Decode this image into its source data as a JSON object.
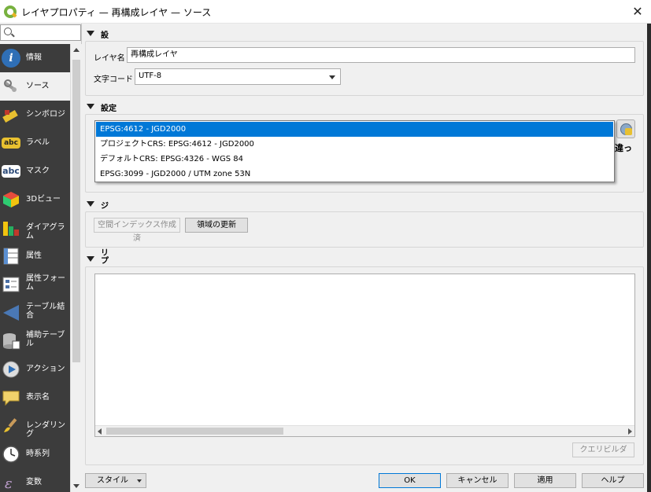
{
  "window": {
    "title": "レイヤプロパティ — 再構成レイヤ — ソース",
    "close_symbol": "✕"
  },
  "sidebar": {
    "search_placeholder": "",
    "items": [
      {
        "label": "情報",
        "icon": "info-icon"
      },
      {
        "label": "ソース",
        "icon": "source-icon"
      },
      {
        "label": "シンボロジ",
        "icon": "symbology-icon"
      },
      {
        "label": "ラベル",
        "icon": "labels-icon"
      },
      {
        "label": "マスク",
        "icon": "mask-icon"
      },
      {
        "label": "3Dビュー",
        "icon": "3d-view-icon"
      },
      {
        "label": "ダイアグラム",
        "icon": "diagram-icon"
      },
      {
        "label": "属性",
        "icon": "attributes-icon"
      },
      {
        "label": "属性フォーム",
        "icon": "attributes-form-icon"
      },
      {
        "label": "テーブル結合",
        "icon": "joins-icon"
      },
      {
        "label": "補助テーブル",
        "icon": "auxiliary-storage-icon"
      },
      {
        "label": "アクション",
        "icon": "actions-icon"
      },
      {
        "label": "表示名",
        "icon": "display-icon"
      },
      {
        "label": "レンダリング",
        "icon": "rendering-icon"
      },
      {
        "label": "時系列",
        "icon": "temporal-icon"
      },
      {
        "label": "変数",
        "icon": "variables-icon"
      }
    ],
    "icon_badges": {
      "labels": "abc",
      "mask": "abc"
    }
  },
  "settings": {
    "title": "設定",
    "layer_name_label": "レイヤ名",
    "layer_name_value": "再構成レイヤ",
    "encoding_label": "文字コード",
    "encoding_value": "UTF-8"
  },
  "crs": {
    "title": "設定されたCRS",
    "options": [
      "EPSG:4612 - JGD2000",
      "プロジェクトCRS: EPSG:4612 - JGD2000",
      "デフォルトCRS: EPSG:4326 - WGS 84",
      "EPSG:3099 - JGD2000 / UTM zone 53N"
    ],
    "selected_index": 0,
    "truncated_text": "違っ"
  },
  "geometry": {
    "title": "ジオメトリ",
    "spatial_index_button": "空間インデックス作成済",
    "update_extents_button": "領域の更新"
  },
  "filter": {
    "title": "プロバイダ地物フィルタ",
    "query_builder_button": "クエリビルダ"
  },
  "footer": {
    "style_label": "スタイル",
    "ok_label": "OK",
    "cancel_label": "キャンセル",
    "apply_label": "適用",
    "help_label": "ヘルプ"
  },
  "colors": {
    "accent": "#0078d7",
    "sidebar_bg": "#3c3c3c"
  }
}
